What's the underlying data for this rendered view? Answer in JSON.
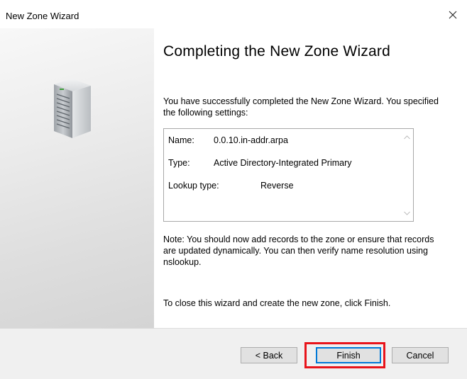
{
  "window": {
    "title": "New Zone Wizard"
  },
  "icons": {
    "close": "close-icon",
    "banner": "server-icon",
    "scroll_up": "chevron-up-icon",
    "scroll_down": "chevron-down-icon"
  },
  "content": {
    "heading": "Completing the New Zone Wizard",
    "intro": "You have successfully completed the New Zone Wizard. You specified the following settings:",
    "settings": [
      {
        "label": "Name:",
        "value": "0.0.10.in-addr.arpa"
      },
      {
        "label": "Type:",
        "value": "Active Directory-Integrated Primary"
      },
      {
        "label": "Lookup type:",
        "value": "Reverse"
      }
    ],
    "note": "Note: You should now add records to the zone or ensure that records are updated dynamically. You can then verify name resolution using nslookup.",
    "closing": "To close this wizard and create the new zone, click Finish."
  },
  "footer": {
    "back_label": "< Back",
    "finish_label": "Finish",
    "cancel_label": "Cancel"
  },
  "colors": {
    "highlight": "#e8141b",
    "focus": "#0078d7",
    "footer_bg": "#f0f0f0",
    "button_bg": "#e1e1e1"
  }
}
